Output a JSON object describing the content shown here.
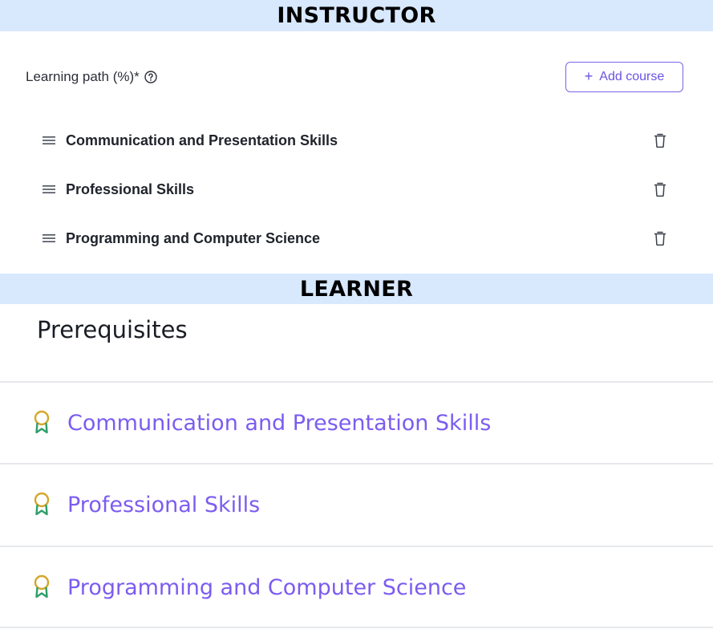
{
  "banners": {
    "instructor": "INSTRUCTOR",
    "learner": "LEARNER"
  },
  "instructor": {
    "learning_path_label": "Learning path (%)*",
    "help_icon": "question-circle-icon",
    "add_course_label": "Add course",
    "courses": [
      {
        "name": "Communication and Presentation Skills"
      },
      {
        "name": "Professional Skills"
      },
      {
        "name": "Programming and Computer Science"
      }
    ]
  },
  "learner": {
    "title": "Prerequisites",
    "items": [
      {
        "name": "Communication and Presentation Skills",
        "icon": "award-ribbon-icon"
      },
      {
        "name": "Professional Skills",
        "icon": "award-ribbon-icon"
      },
      {
        "name": "Programming and Computer Science",
        "icon": "award-ribbon-icon"
      }
    ]
  },
  "colors": {
    "banner_bg": "#d8e8fd",
    "accent_purple": "#7b5cf0",
    "award_green": "#2e9e6a",
    "award_gold": "#d4a72c"
  }
}
